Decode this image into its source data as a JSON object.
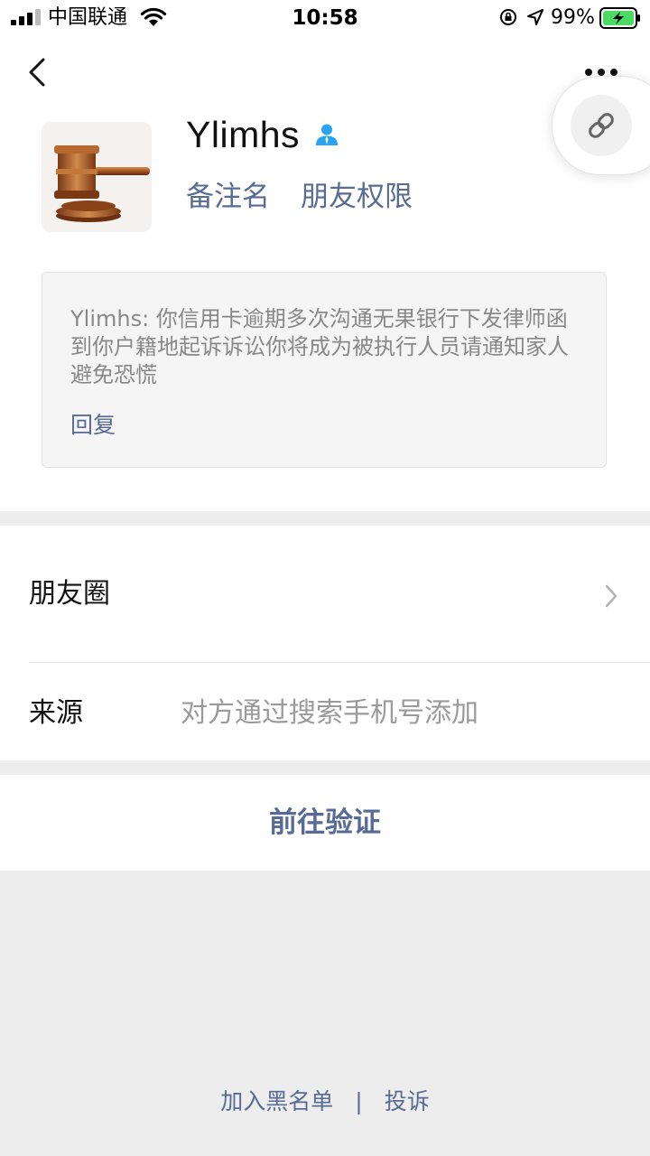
{
  "status_bar": {
    "carrier": "中国联通",
    "time": "10:58",
    "battery": "99%",
    "signal_icon": "signal-bars-icon",
    "wifi_icon": "wifi-icon",
    "lock_icon": "orientation-lock-icon",
    "location_icon": "location-arrow-icon",
    "battery_icon": "battery-charging-icon"
  },
  "header": {
    "back_icon": "chevron-left-icon",
    "more_icon": "more-dots-icon",
    "link_icon": "link-icon"
  },
  "profile": {
    "name": "Ylimhs",
    "gender_icon": "person-icon",
    "avatar_icon": "gavel-icon",
    "actions": [
      "备注名",
      "朋友权限"
    ]
  },
  "message": {
    "text": "Ylimhs: 你信用卡逾期多次沟通无果银行下发律师函到你户籍地起诉诉讼你将成为被执行人员请通知家人避免恐慌",
    "reply_label": "回复"
  },
  "cells": {
    "moments": {
      "title": "朋友圈"
    },
    "source": {
      "title": "来源",
      "value": "对方通过搜索手机号添加"
    }
  },
  "verify": {
    "label": "前往验证"
  },
  "footer": {
    "blacklist_label": "加入黑名单",
    "separator": "|",
    "report_label": "投诉"
  },
  "colors": {
    "link": "#576b95",
    "page_bg": "#ededed",
    "battery_green": "#4cd964",
    "gender_blue": "#2aa3f0"
  }
}
